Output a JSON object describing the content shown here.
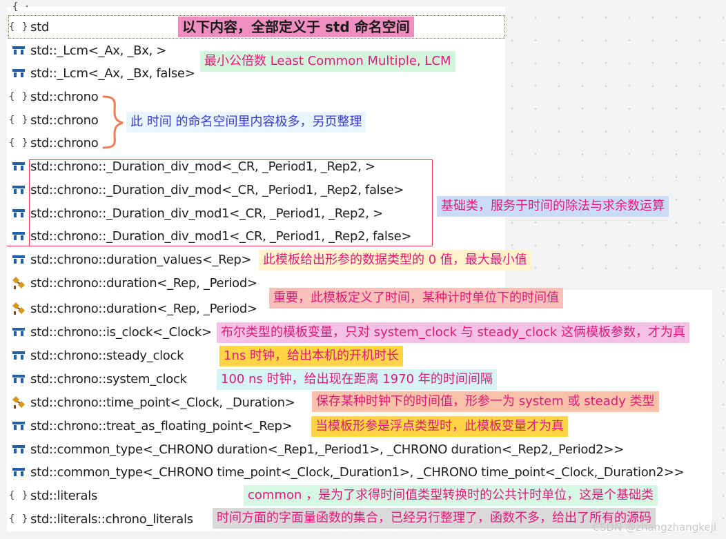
{
  "colors": {
    "struct_icon": "#1f5fad",
    "template_icon_a": "#d89a1a",
    "template_icon_b": "#7a4a2a",
    "frame_red": "#e43d55",
    "brace_orange": "#f07a52"
  },
  "items": [
    {
      "icon": "namespace-icon",
      "label": "std"
    },
    {
      "icon": "struct-icon",
      "label": "std::_Lcm<_Ax, _Bx, >"
    },
    {
      "icon": "struct-icon",
      "label": "std::_Lcm<_Ax, _Bx, false>"
    },
    {
      "icon": "namespace-icon",
      "label": "std::chrono"
    },
    {
      "icon": "namespace-icon",
      "label": "std::chrono"
    },
    {
      "icon": "namespace-icon",
      "label": "std::chrono"
    },
    {
      "icon": "struct-icon",
      "label": "std::chrono::_Duration_div_mod<_CR, _Period1, _Rep2, >"
    },
    {
      "icon": "struct-icon",
      "label": "std::chrono::_Duration_div_mod<_CR, _Period1, _Rep2, false>"
    },
    {
      "icon": "struct-icon",
      "label": "std::chrono::_Duration_div_mod1<_CR, _Period1, _Rep2, >"
    },
    {
      "icon": "struct-icon",
      "label": "std::chrono::_Duration_div_mod1<_CR, _Period1, _Rep2, false>"
    },
    {
      "icon": "struct-icon",
      "label": "std::chrono::duration_values<_Rep>"
    },
    {
      "icon": "class-template-icon",
      "label": "std::chrono::duration<_Rep, _Period>"
    },
    {
      "icon": "class-template-icon",
      "label": "std::chrono::duration<_Rep, _Period>"
    },
    {
      "icon": "struct-icon",
      "label": "std::chrono::is_clock<_Clock>"
    },
    {
      "icon": "struct-icon",
      "label": "std::chrono::steady_clock"
    },
    {
      "icon": "struct-icon",
      "label": "std::chrono::system_clock"
    },
    {
      "icon": "class-template-icon",
      "label": "std::chrono::time_point<_Clock, _Duration>"
    },
    {
      "icon": "struct-icon",
      "label": "std::chrono::treat_as_floating_point<_Rep>"
    },
    {
      "icon": "struct-icon",
      "label": "std::common_type<_CHRONO duration<_Rep1,_Period1>, _CHRONO duration<_Rep2,_Period2>>"
    },
    {
      "icon": "struct-icon",
      "label": "std::common_type<_CHRONO time_point<_Clock,_Duration1>, _CHRONO time_point<_Clock,_Duration2>>"
    },
    {
      "icon": "namespace-icon",
      "label": "std::literals"
    },
    {
      "icon": "namespace-icon",
      "label": "std::literals::chrono_literals"
    }
  ],
  "notes": {
    "n_std": {
      "text": "以下内容，全部定义于 std 命名空间",
      "bg": "#ef8fc0",
      "color": "#1a1a1a"
    },
    "n_lcm": {
      "text": "最小公倍数 Least Common Multiple, LCM",
      "bg": "#d2f5dc",
      "color": "#e0197a"
    },
    "n_chrono": {
      "text": "此 时间 的命名空间里内容极多，另页整理",
      "bg": "#e8f6ff",
      "color": "#3a3acb"
    },
    "n_divmod": {
      "text": "基础类，服务于时间的除法与求余数运算",
      "bg": "#c9dbf7",
      "color": "#e0197a"
    },
    "n_durvals": {
      "text": "此模板给出形参的数据类型的 0 值，最大最小值",
      "bg": "#fff3cc",
      "color": "#e0197a"
    },
    "n_duration": {
      "text": "重要，此模板定义了时间，某种计时单位下的时间值",
      "bg": "#f8c0b8",
      "color": "#e0197a"
    },
    "n_isclock": {
      "text": "布尔类型的模板变量，只对 system_clock 与 steady_clock 这俩模板参数，才为真",
      "bg": "#f5c0e6",
      "color": "#e0197a"
    },
    "n_steady": {
      "text": "1ns 时钟，给出本机的开机时长",
      "bg": "#ffd445",
      "color": "#e0197a"
    },
    "n_system": {
      "text": "100 ns 时钟，给出现在距离 1970 年的时间间隔",
      "bg": "#d6f4f6",
      "color": "#e0197a"
    },
    "n_timepoint": {
      "text": "保存某种时钟下的时间值，形参一为 system 或 steady 类型",
      "bg": "#f9c2a8",
      "color": "#e0197a"
    },
    "n_floating": {
      "text": "当模板形参是浮点类型时，此模板变量才为真",
      "bg": "#ffd445",
      "color": "#e0197a"
    },
    "n_common": {
      "text": "common ，是为了求得时间值类型转换时的公共计时单位，这是个基础类",
      "bg": "#d6f7e4",
      "color": "#e0197a"
    },
    "n_literals": {
      "text": "时间方面的字面量函数的集合，已经另行整理了，函数不多，给出了所有的源码",
      "bg": "#d9d9d9",
      "color": "#e0197a"
    }
  },
  "watermark": "CSDN @zhangzhangkeji",
  "topclip": "{ ·"
}
